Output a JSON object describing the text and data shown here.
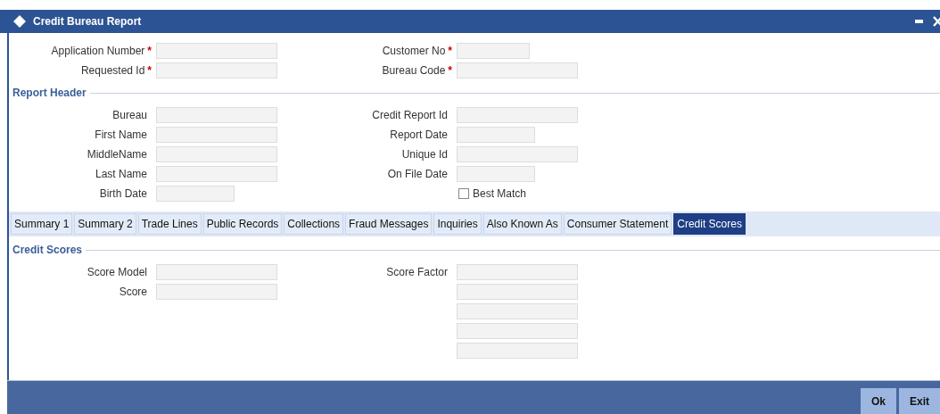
{
  "window": {
    "title": "Credit Bureau Report"
  },
  "top_fields": [
    {
      "left": {
        "label": "Application Number",
        "required_mark": "*",
        "kind": "long"
      },
      "right": {
        "label": "Customer No",
        "required_mark": "*",
        "kind": "short"
      }
    },
    {
      "left": {
        "label": "Requested Id",
        "required_mark": "*",
        "kind": "long"
      },
      "right": {
        "label": "Bureau Code",
        "required_mark": "*",
        "kind": "long"
      }
    }
  ],
  "report_header": {
    "title": "Report Header",
    "rows": [
      {
        "left": {
          "label": "Bureau",
          "kind": "long"
        },
        "right": {
          "label": "Credit Report Id",
          "kind": "long"
        }
      },
      {
        "left": {
          "label": "First Name",
          "kind": "long"
        },
        "right": {
          "label": "Report Date",
          "kind": "short"
        }
      },
      {
        "left": {
          "label": "MiddleName",
          "kind": "long"
        },
        "right": {
          "label": "Unique Id",
          "kind": "long"
        }
      },
      {
        "left": {
          "label": "Last Name",
          "kind": "long"
        },
        "right": {
          "label": "On File Date",
          "kind": "short"
        }
      },
      {
        "left": {
          "label": "Birth Date",
          "kind": "short"
        },
        "right": {
          "label": "Best Match",
          "kind": "checkbox",
          "checked": false
        }
      }
    ]
  },
  "tabs": [
    {
      "label": "Summary 1",
      "selected": false
    },
    {
      "label": "Summary 2",
      "selected": false
    },
    {
      "label": "Trade Lines",
      "selected": false
    },
    {
      "label": "Public Records",
      "selected": false
    },
    {
      "label": "Collections",
      "selected": false
    },
    {
      "label": "Fraud Messages",
      "selected": false
    },
    {
      "label": "Inquiries",
      "selected": false
    },
    {
      "label": "Also Known As",
      "selected": false
    },
    {
      "label": "Consumer Statement",
      "selected": false
    },
    {
      "label": "Credit Scores",
      "selected": true
    }
  ],
  "credit_scores": {
    "title": "Credit Scores",
    "rows": [
      {
        "left": {
          "label": "Score Model",
          "kind": "long"
        },
        "right": {
          "label": "Score Factor",
          "kind": "long"
        }
      },
      {
        "left": {
          "label": "Score",
          "kind": "long"
        },
        "right": {
          "kind": "long"
        }
      },
      {
        "right": {
          "kind": "long"
        }
      },
      {
        "right": {
          "kind": "long"
        }
      },
      {
        "right": {
          "kind": "long"
        }
      }
    ]
  },
  "buttons": [
    "Ok",
    "Exit"
  ]
}
